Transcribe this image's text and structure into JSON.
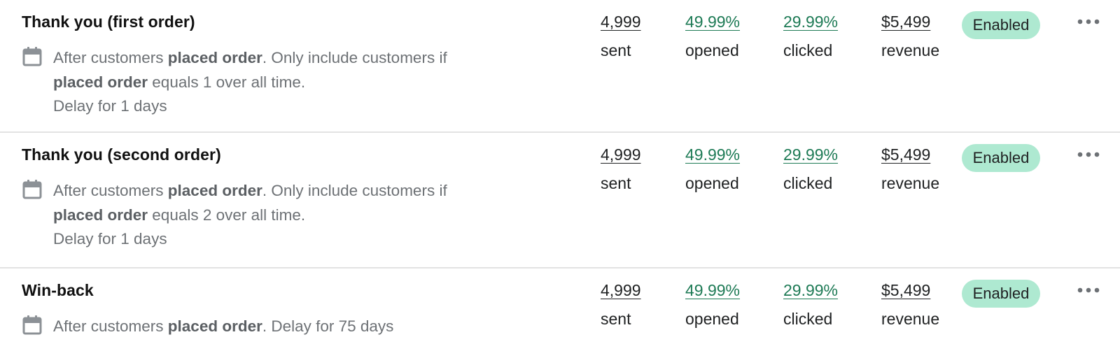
{
  "automations": [
    {
      "title": "Thank you (first order)",
      "trigger": {
        "prefix": "After customers ",
        "event": "placed order",
        "mid": ". Only include customers if ",
        "filter_event": "placed order",
        "filter_rest": " equals 1 over all time.",
        "delay": "Delay for 1 days"
      },
      "stats": {
        "sent_value": "4,999",
        "sent_label": "sent",
        "opened_value": "49.99%",
        "opened_label": "opened",
        "clicked_value": "29.99%",
        "clicked_label": "clicked",
        "revenue_value": "$5,499",
        "revenue_label": "revenue"
      },
      "status": "Enabled"
    },
    {
      "title": "Thank you (second order)",
      "trigger": {
        "prefix": "After customers ",
        "event": "placed order",
        "mid": ". Only include customers if ",
        "filter_event": "placed order",
        "filter_rest": " equals 2 over all time.",
        "delay": "Delay for 1 days"
      },
      "stats": {
        "sent_value": "4,999",
        "sent_label": "sent",
        "opened_value": "49.99%",
        "opened_label": "opened",
        "clicked_value": "29.99%",
        "clicked_label": "clicked",
        "revenue_value": "$5,499",
        "revenue_label": "revenue"
      },
      "status": "Enabled"
    },
    {
      "title": "Win-back",
      "trigger": {
        "prefix": "After customers ",
        "event": "placed order",
        "mid": ". Delay for 75 days"
      },
      "stats": {
        "sent_value": "4,999",
        "sent_label": "sent",
        "opened_value": "49.99%",
        "opened_label": "opened",
        "clicked_value": "29.99%",
        "clicked_label": "clicked",
        "revenue_value": "$5,499",
        "revenue_label": "revenue"
      },
      "status": "Enabled"
    }
  ],
  "icons": {
    "calendar": "calendar-icon",
    "more": "more-horizontal-icon"
  },
  "colors": {
    "rate_link": "#1d7a55",
    "badge_bg": "#aee9d1",
    "muted_text": "#6d7175",
    "divider": "#e3e3e3"
  }
}
